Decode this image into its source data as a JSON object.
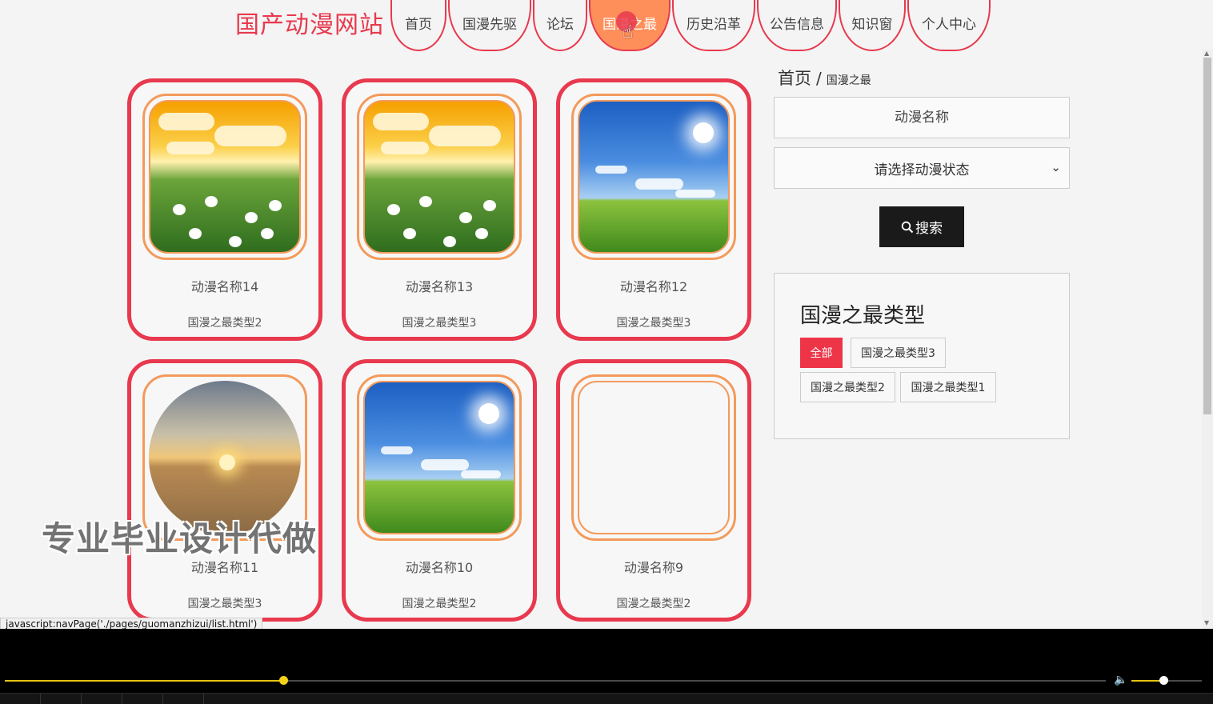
{
  "site": {
    "title": "国产动漫网站"
  },
  "nav": [
    {
      "label": "首页",
      "active": false
    },
    {
      "label": "国漫先驱",
      "active": false
    },
    {
      "label": "论坛",
      "active": false
    },
    {
      "label": "国漫之最",
      "active": true
    },
    {
      "label": "历史沿革",
      "active": false
    },
    {
      "label": "公告信息",
      "active": false
    },
    {
      "label": "知识窗",
      "active": false
    },
    {
      "label": "个人中心",
      "active": false
    }
  ],
  "cards": [
    {
      "name": "动漫名称14",
      "type": "国漫之最类型2",
      "picture": "sunset-daisy-field"
    },
    {
      "name": "动漫名称13",
      "type": "国漫之最类型3",
      "picture": "sunset-daisy-field"
    },
    {
      "name": "动漫名称12",
      "type": "国漫之最类型3",
      "picture": "blue-sky-meadow"
    },
    {
      "name": "动漫名称11",
      "type": "国漫之最类型3",
      "picture": "desert-sunset"
    },
    {
      "name": "动漫名称10",
      "type": "国漫之最类型2",
      "picture": "blue-sky-meadow"
    },
    {
      "name": "动漫名称9",
      "type": "国漫之最类型2",
      "picture": "blank"
    }
  ],
  "breadcrumb": {
    "home": "首页",
    "separator": "/",
    "current": "国漫之最"
  },
  "search": {
    "placeholder": "动漫名称",
    "status_select": "请选择动漫状态",
    "button_label": "搜索"
  },
  "type_panel": {
    "title": "国漫之最类型",
    "tags": [
      {
        "label": "全部",
        "active": true
      },
      {
        "label": "国漫之最类型3",
        "active": false
      },
      {
        "label": "国漫之最类型2",
        "active": false
      },
      {
        "label": "国漫之最类型1",
        "active": false
      }
    ]
  },
  "watermark": "专业毕业设计代做",
  "status_url": "javascript:navPage('./pages/guomanzhizui/list.html')",
  "player": {
    "progress_fraction": 0.253,
    "volume_fraction": 0.45
  },
  "colors": {
    "accent": "#e8394e",
    "ring": "#f39a5b",
    "nav_active": "#ff8f5a",
    "progress": "#e5c312"
  },
  "icons": {
    "search": "search-icon",
    "select": "chevron-down-icon",
    "volume": "volume-icon"
  }
}
